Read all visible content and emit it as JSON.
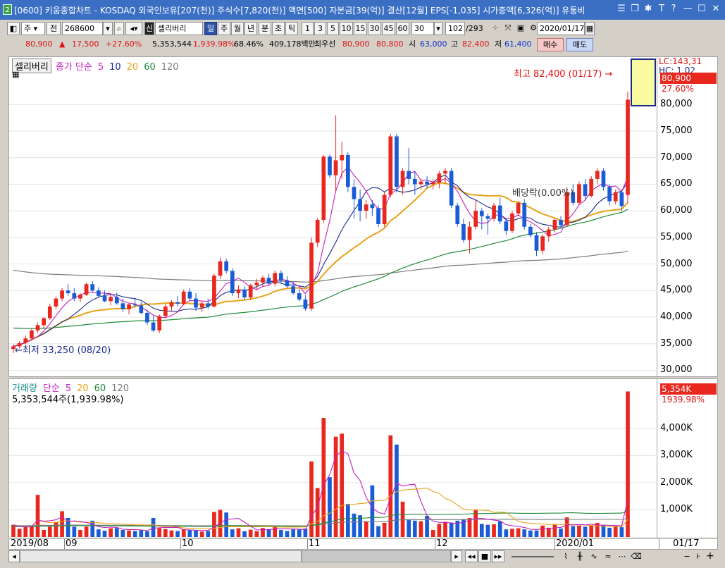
{
  "window": {
    "title": "[0600] 키움종합차트 - KOSDAQ 외국인보유[207(천)] 주식수[7,820(천)] 액면[500] 자본금[39(억)] 결산[12월] EPS[-1,035] 시가총액[6,326(억)] 유통비",
    "icon_label": "2"
  },
  "toolbar": {
    "period_select": "주",
    "prev_label": "전",
    "stock_code": "268600",
    "credit_badge": "신",
    "stock_name": "셀리버리",
    "period_tabs": [
      "일",
      "주",
      "월",
      "년",
      "분",
      "초",
      "틱"
    ],
    "active_tab": "일",
    "intervals": [
      "1",
      "3",
      "5",
      "10",
      "15",
      "30",
      "45",
      "60"
    ],
    "interval_value": "30",
    "count_value": "102",
    "count_total": "/293",
    "date_value": "2020/01/17"
  },
  "quote": {
    "price": "80,900",
    "change_arrow": "▲",
    "change": "17,500",
    "change_pct": "+27.60%",
    "volume": "5,353,544",
    "volume_pct": "1,939.98%",
    "ratio": "68.46%",
    "amount": "409,178백만",
    "best_bid_label": "최우선",
    "ask_price": "80,900",
    "bid_price": "80,800",
    "open_label": "시",
    "open": "63,000",
    "high_label": "고",
    "high": "82,400",
    "low_label": "저",
    "low": "61,400",
    "buy_label": "매수",
    "sell_label": "매도"
  },
  "price_panel": {
    "stock_tag": "셀리버리",
    "ma_title": "종가 단순",
    "ma_periods": [
      "5",
      "10",
      "20",
      "60",
      "120"
    ],
    "high_annotation": "최고 82,400 (01/17) →",
    "low_annotation": "←최저 33,250 (08/20)",
    "dividend_annotation": "배당락(0.00%)",
    "scale_lc": "LC:143,31",
    "scale_hc": "HC: 1.02",
    "current_price_tag": "80,900",
    "current_pct_tag": "27.60%"
  },
  "volume_panel": {
    "title": "거래량",
    "ma_title": "단순",
    "ma_periods": [
      "5",
      "20",
      "60",
      "120"
    ],
    "summary": "5,353,544주(1,939.98%)",
    "current_tag": "5,354K",
    "current_pct": "1939.98%"
  },
  "x_axis": {
    "labels": [
      "2019/08",
      "09",
      "10",
      "11",
      "12",
      "2020/01"
    ],
    "end_label": "01/17"
  },
  "colors": {
    "up": "#e8271e",
    "down": "#1a5cd6",
    "ma5": "#c51fbf",
    "ma10": "#1a2a8c",
    "ma20": "#e8a317",
    "ma60": "#1f8a3a",
    "ma120": "#7b7b7b"
  },
  "chart_data": [
    {
      "type": "candlestick",
      "title": "셀리버리",
      "ylim": [
        29000,
        86000
      ],
      "y_ticks": [
        30000,
        35000,
        40000,
        45000,
        50000,
        55000,
        60000,
        65000,
        70000,
        75000,
        80000
      ],
      "y_tick_labels": [
        "30,000",
        "35,000",
        "40,000",
        "45,000",
        "50,000",
        "55,000",
        "60,000",
        "65,000",
        "70,000",
        "75,000",
        "80,000"
      ],
      "x_labels": [
        "2019/08",
        "09",
        "10",
        "11",
        "12",
        "2020/01"
      ],
      "legend": [
        "5",
        "10",
        "20",
        "60",
        "120"
      ],
      "ohlc": [
        [
          34000,
          34900,
          33250,
          34500
        ],
        [
          34500,
          35500,
          34100,
          35100
        ],
        [
          35200,
          36500,
          34800,
          36000
        ],
        [
          36000,
          37800,
          35600,
          37500
        ],
        [
          37500,
          39000,
          37000,
          38500
        ],
        [
          38500,
          40000,
          38000,
          39800
        ],
        [
          39800,
          42500,
          39500,
          42000
        ],
        [
          42000,
          43900,
          41500,
          43500
        ],
        [
          43500,
          45500,
          43000,
          45000
        ],
        [
          45000,
          46200,
          44000,
          44500
        ],
        [
          44500,
          45500,
          43000,
          43500
        ],
        [
          43500,
          44500,
          42800,
          44200
        ],
        [
          44200,
          46500,
          44000,
          46200
        ],
        [
          46200,
          46800,
          44800,
          45000
        ],
        [
          45000,
          45600,
          43600,
          44000
        ],
        [
          44000,
          45000,
          42800,
          43000
        ],
        [
          43000,
          44200,
          42200,
          43800
        ],
        [
          43800,
          44600,
          42300,
          42600
        ],
        [
          42600,
          43500,
          41000,
          41500
        ],
        [
          41500,
          42700,
          40500,
          42400
        ],
        [
          42400,
          43600,
          41800,
          42200
        ],
        [
          42200,
          42800,
          40500,
          40800
        ],
        [
          40800,
          41400,
          38500,
          39000
        ],
        [
          39000,
          40200,
          37200,
          37500
        ],
        [
          37500,
          40500,
          37000,
          40200
        ],
        [
          40200,
          42500,
          39800,
          42000
        ],
        [
          42000,
          43200,
          41200,
          42800
        ],
        [
          42800,
          44000,
          42000,
          42500
        ],
        [
          42500,
          45200,
          42200,
          44800
        ],
        [
          44800,
          45500,
          43000,
          43500
        ],
        [
          43500,
          44500,
          41200,
          41800
        ],
        [
          41800,
          43000,
          41000,
          42600
        ],
        [
          42600,
          43500,
          41500,
          42000
        ],
        [
          42000,
          48200,
          41800,
          47800
        ],
        [
          47800,
          51200,
          47200,
          50500
        ],
        [
          50500,
          51000,
          48200,
          48700
        ],
        [
          48700,
          49200,
          44000,
          44500
        ],
        [
          44500,
          46000,
          43600,
          45200
        ],
        [
          45200,
          45800,
          43200,
          43700
        ],
        [
          43700,
          46300,
          43200,
          46000
        ],
        [
          46000,
          47200,
          45200,
          46500
        ],
        [
          46500,
          47800,
          45800,
          47400
        ],
        [
          47400,
          48200,
          46000,
          46300
        ],
        [
          46300,
          48800,
          45800,
          48300
        ],
        [
          48300,
          48800,
          46500,
          46900
        ],
        [
          46900,
          47700,
          45500,
          45800
        ],
        [
          45800,
          46600,
          44200,
          44500
        ],
        [
          44500,
          45300,
          43000,
          43300
        ],
        [
          43300,
          44100,
          41200,
          41600
        ],
        [
          41600,
          55000,
          41200,
          54000
        ],
        [
          54000,
          58600,
          53200,
          58300
        ],
        [
          58300,
          70500,
          57700,
          70200
        ],
        [
          70200,
          70600,
          66200,
          66700
        ],
        [
          66700,
          78000,
          63500,
          69500
        ],
        [
          69500,
          73000,
          66000,
          70500
        ],
        [
          70500,
          71000,
          63500,
          64500
        ],
        [
          64500,
          66000,
          58500,
          62200
        ],
        [
          62200,
          64000,
          58000,
          60000
        ],
        [
          60000,
          62000,
          58500,
          61200
        ],
        [
          61200,
          62000,
          59000,
          60500
        ],
        [
          60500,
          61000,
          57000,
          57500
        ],
        [
          57500,
          63500,
          57000,
          63000
        ],
        [
          63000,
          74500,
          62500,
          74000
        ],
        [
          74000,
          74500,
          63500,
          64500
        ],
        [
          64500,
          68000,
          63000,
          67500
        ],
        [
          67500,
          71800,
          65000,
          66000
        ],
        [
          66000,
          67500,
          63000,
          65000
        ],
        [
          65000,
          66000,
          64000,
          65500
        ],
        [
          65500,
          66500,
          64200,
          65000
        ],
        [
          65000,
          66000,
          64000,
          65300
        ],
        [
          65300,
          67500,
          64200,
          67000
        ],
        [
          67000,
          68000,
          65000,
          67500
        ],
        [
          67500,
          68000,
          60500,
          61000
        ],
        [
          61000,
          61500,
          57000,
          57500
        ],
        [
          57500,
          58500,
          54000,
          54500
        ],
        [
          54500,
          58000,
          52000,
          57000
        ],
        [
          57000,
          62000,
          56500,
          60000
        ],
        [
          60000,
          60500,
          56500,
          59000
        ],
        [
          59000,
          59500,
          55500,
          58500
        ],
        [
          58500,
          61500,
          58000,
          61000
        ],
        [
          61000,
          62500,
          57500,
          58000
        ],
        [
          58000,
          58500,
          55500,
          56200
        ],
        [
          56200,
          60000,
          55800,
          59500
        ],
        [
          59500,
          61800,
          59000,
          61500
        ],
        [
          61500,
          62200,
          56500,
          57000
        ],
        [
          57000,
          57500,
          55000,
          55400
        ],
        [
          55400,
          56000,
          51500,
          52500
        ],
        [
          52500,
          55500,
          51800,
          55200
        ],
        [
          55200,
          57000,
          54200,
          56500
        ],
        [
          56500,
          58500,
          56000,
          58300
        ],
        [
          58300,
          59000,
          56800,
          57300
        ],
        [
          57300,
          64500,
          57000,
          63500
        ],
        [
          63500,
          65000,
          61000,
          61500
        ],
        [
          61500,
          65500,
          61000,
          65000
        ],
        [
          65000,
          66000,
          62000,
          62800
        ],
        [
          62800,
          66500,
          62500,
          66000
        ],
        [
          66000,
          68000,
          65000,
          67500
        ],
        [
          67500,
          68000,
          63800,
          64500
        ],
        [
          64500,
          65000,
          61000,
          61800
        ],
        [
          61800,
          64000,
          61200,
          63500
        ],
        [
          63500,
          64000,
          60000,
          60900
        ],
        [
          63000,
          82400,
          61400,
          80900
        ]
      ]
    },
    {
      "type": "bar",
      "title": "거래량",
      "ylim": [
        0,
        5600000
      ],
      "y_ticks": [
        1000000,
        2000000,
        3000000,
        4000000
      ],
      "y_tick_labels": [
        "1,000K",
        "2,000K",
        "3,000K",
        "4,000K"
      ],
      "legend": [
        "5",
        "20",
        "60",
        "120"
      ],
      "values": [
        450000,
        300000,
        380000,
        420000,
        1550000,
        260000,
        380000,
        550000,
        950000,
        700000,
        380000,
        260000,
        380000,
        600000,
        280000,
        230000,
        320000,
        330000,
        260000,
        240000,
        220000,
        250000,
        210000,
        700000,
        320000,
        290000,
        240000,
        220000,
        280000,
        260000,
        240000,
        200000,
        220000,
        920000,
        1000000,
        900000,
        280000,
        320000,
        210000,
        270000,
        210000,
        330000,
        290000,
        410000,
        260000,
        220000,
        280000,
        270000,
        310000,
        2780000,
        1800000,
        4380000,
        2200000,
        3690000,
        3800000,
        1220000,
        860000,
        800000,
        580000,
        1900000,
        400000,
        520000,
        3740000,
        3400000,
        1300000,
        650000,
        600000,
        580000,
        780000,
        260000,
        480000,
        560000,
        520000,
        600000,
        640000,
        700000,
        1000000,
        480000,
        450000,
        470000,
        580000,
        280000,
        300000,
        320000,
        280000,
        240000,
        240000,
        420000,
        340000,
        450000,
        310000,
        720000,
        400000,
        420000,
        380000,
        440000,
        520000,
        440000,
        340000,
        380000,
        360000,
        5354000
      ]
    }
  ]
}
